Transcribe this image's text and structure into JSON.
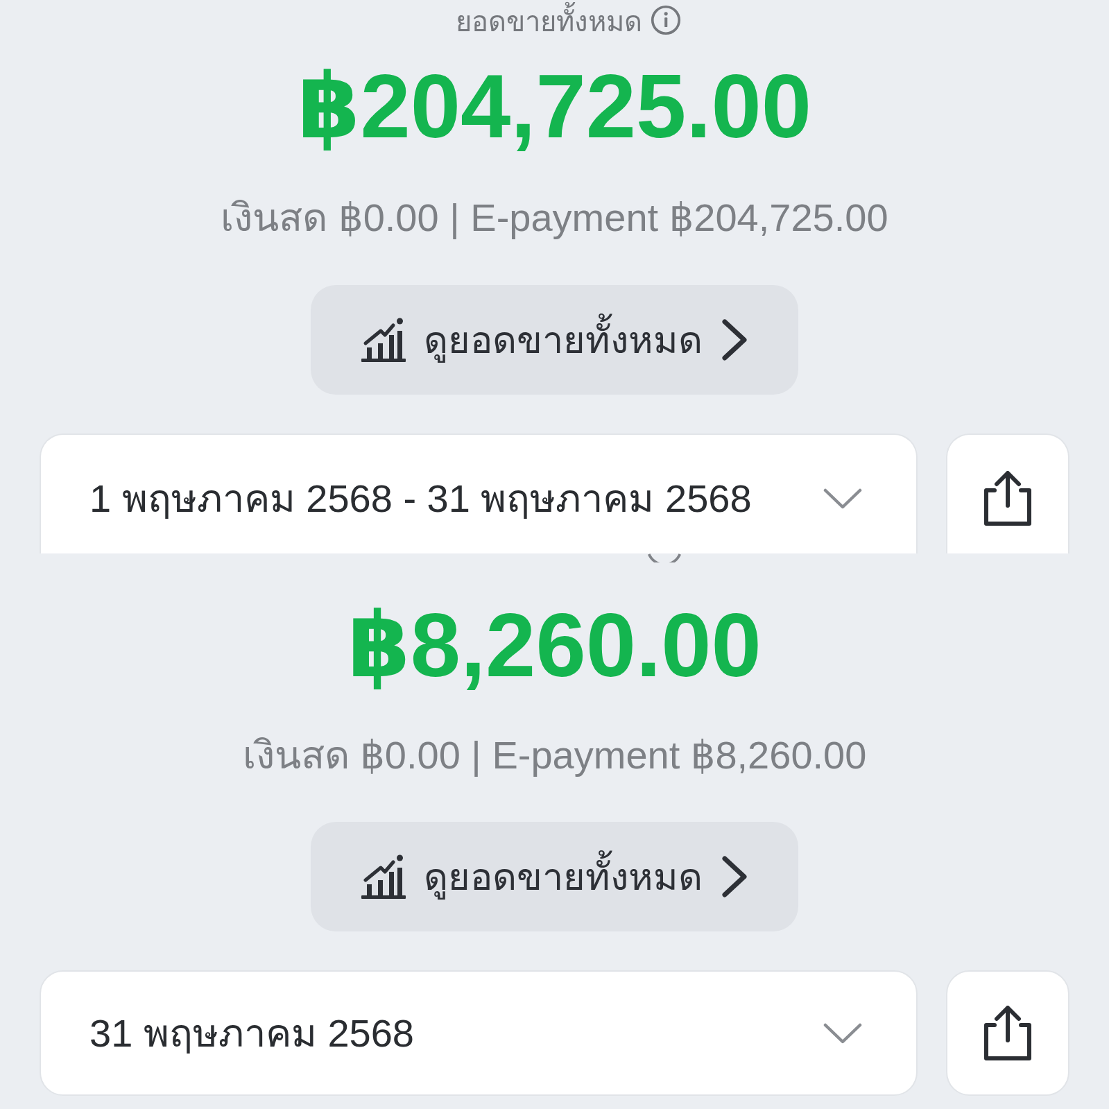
{
  "panels": [
    {
      "heading": "ยอดขายทั้งหมด",
      "total": "฿204,725.00",
      "breakdown": "เงินสด ฿0.00 | E-payment ฿204,725.00",
      "view_button": "ดูยอดขายทั้งหมด",
      "date_range": "1 พฤษภาคม 2568 - 31 พฤษภาคม 2568"
    },
    {
      "total": "฿8,260.00",
      "breakdown": "เงินสด ฿0.00 | E-payment ฿8,260.00",
      "view_button": "ดูยอดขายทั้งหมด",
      "date_range": "31 พฤษภาคม 2568"
    }
  ]
}
